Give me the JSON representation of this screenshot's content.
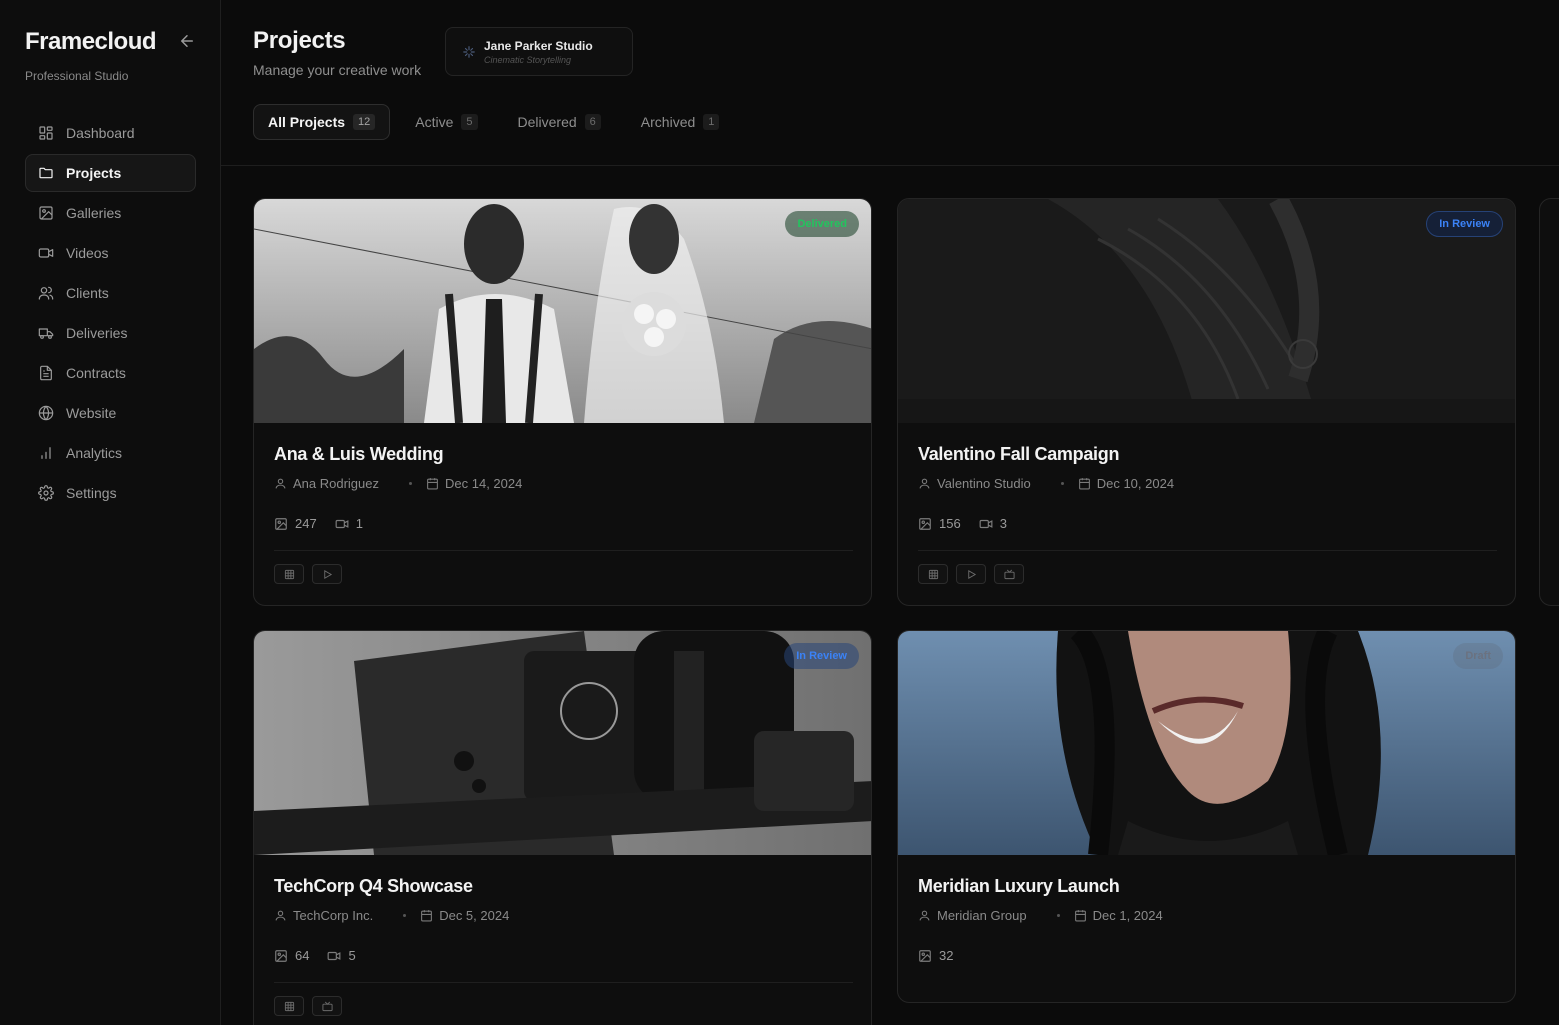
{
  "app": {
    "name": "Framecloud",
    "subtitle": "Professional Studio"
  },
  "sidebar": {
    "items": [
      {
        "label": "Dashboard",
        "icon": "dashboard-icon"
      },
      {
        "label": "Projects",
        "icon": "folder-icon",
        "active": true
      },
      {
        "label": "Galleries",
        "icon": "image-icon"
      },
      {
        "label": "Videos",
        "icon": "video-icon"
      },
      {
        "label": "Clients",
        "icon": "users-icon"
      },
      {
        "label": "Deliveries",
        "icon": "truck-icon"
      },
      {
        "label": "Contracts",
        "icon": "file-icon"
      },
      {
        "label": "Website",
        "icon": "globe-icon"
      },
      {
        "label": "Analytics",
        "icon": "bar-chart-icon"
      },
      {
        "label": "Settings",
        "icon": "gear-icon"
      }
    ]
  },
  "header": {
    "title": "Projects",
    "subtitle": "Manage your creative work",
    "studio": {
      "name": "Jane Parker Studio",
      "tagline": "Cinematic Storytelling"
    },
    "tabs": [
      {
        "label": "All Projects",
        "count": "12",
        "active": true
      },
      {
        "label": "Active",
        "count": "5"
      },
      {
        "label": "Delivered",
        "count": "6"
      },
      {
        "label": "Archived",
        "count": "1"
      }
    ]
  },
  "projects": [
    {
      "title": "Ana & Luis Wedding",
      "client": "Ana Rodriguez",
      "date": "Dec 14, 2024",
      "photos": "247",
      "videos": "1",
      "status": "Delivered",
      "status_color": "#22c55e"
    },
    {
      "title": "Valentino Fall Campaign",
      "client": "Valentino Studio",
      "date": "Dec 10, 2024",
      "photos": "156",
      "videos": "3",
      "status": "In Review",
      "status_color": "#3b82f6"
    },
    {
      "title": "TechCorp Q4 Showcase",
      "client": "TechCorp Inc.",
      "date": "Dec 5, 2024",
      "photos": "64",
      "videos": "5",
      "status": "In Review",
      "status_color": "#3b82f6"
    },
    {
      "title": "Meridian Luxury Launch",
      "client": "Meridian Group",
      "date": "Dec 1, 2024",
      "photos": "32",
      "videos": "",
      "status": "Draft",
      "status_color": "#6b7280"
    }
  ]
}
